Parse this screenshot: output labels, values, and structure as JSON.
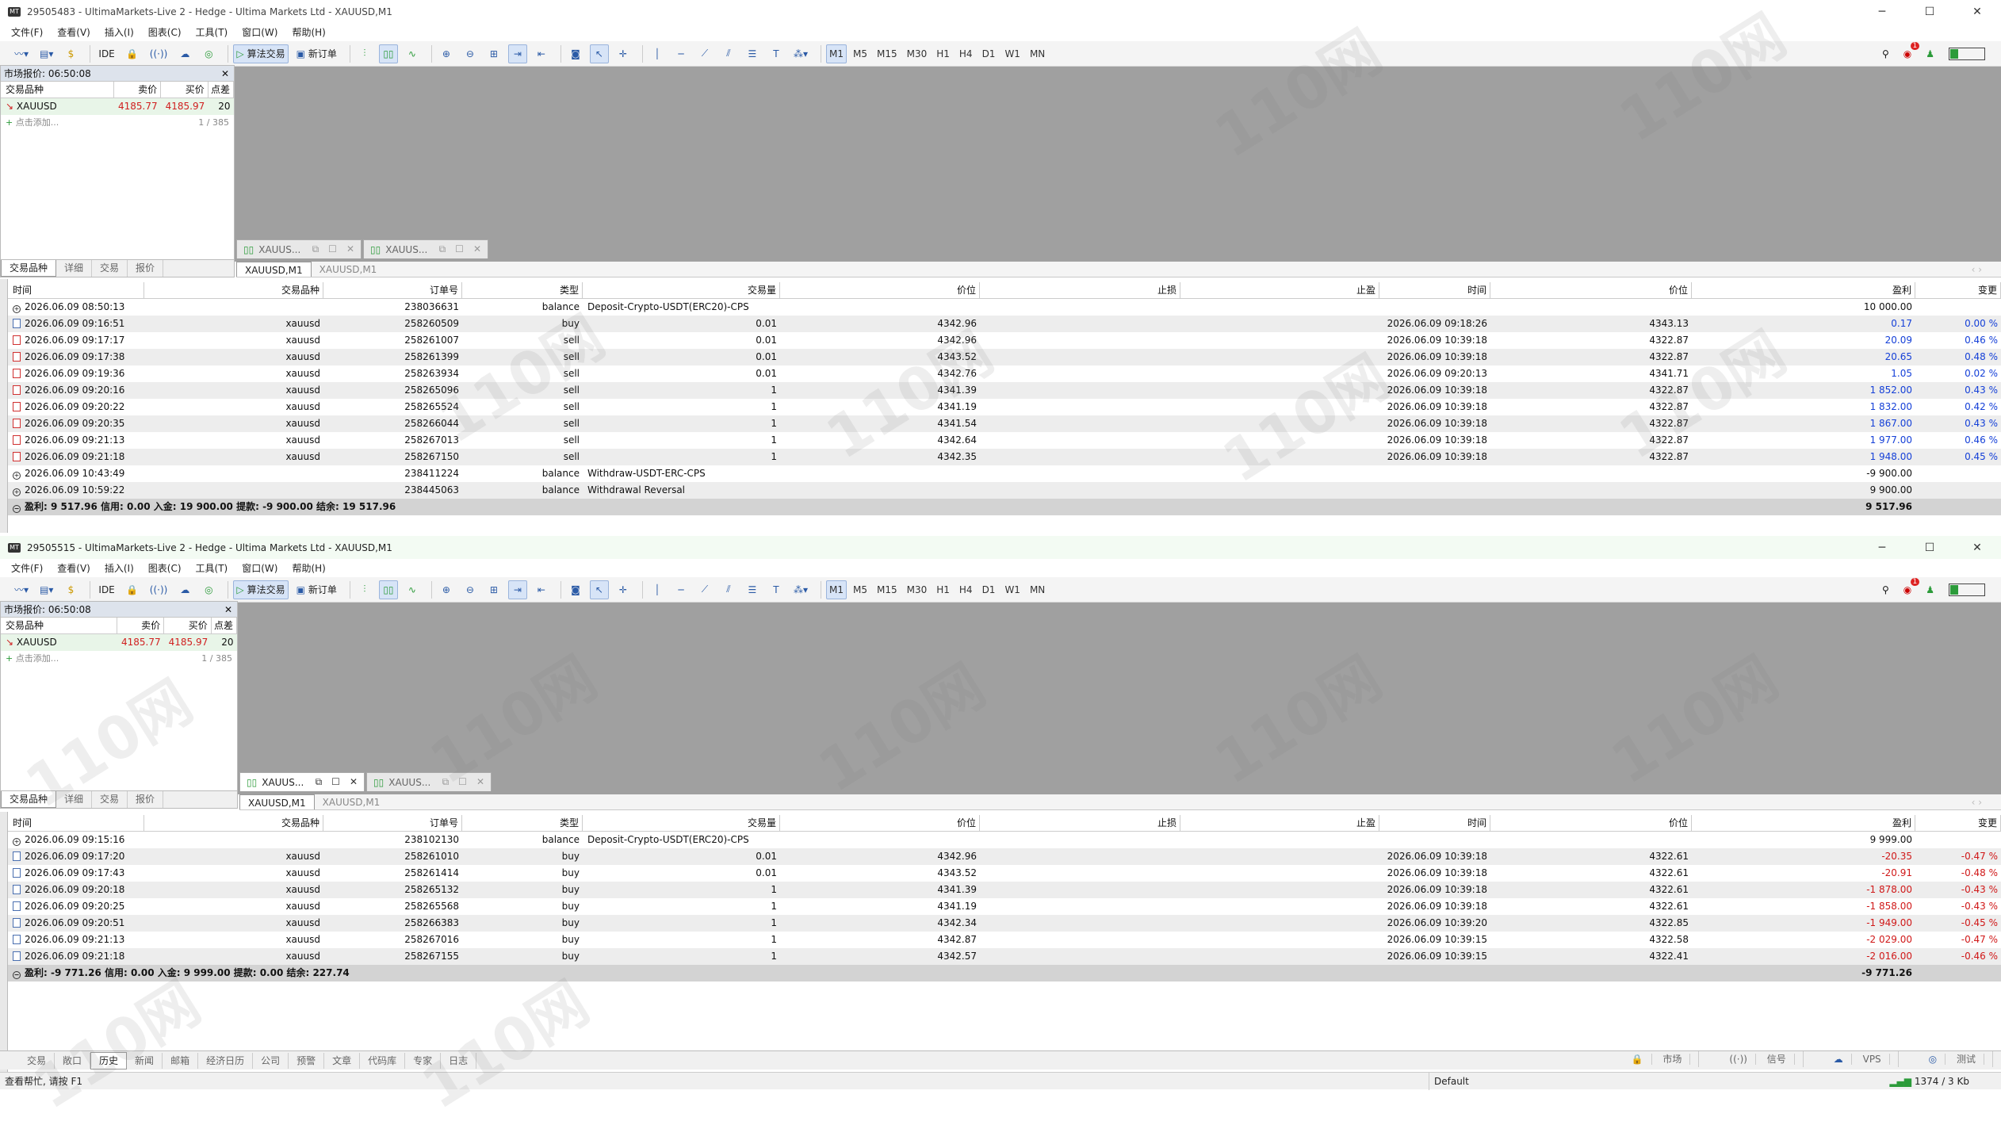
{
  "windows": [
    {
      "title": "29505483 - UltimaMarkets-Live 2 - Hedge - Ultima Markets Ltd - XAUUSD,M1",
      "history": {
        "rows": [
          {
            "time": "2026.06.09 08:50:13",
            "symbol": "",
            "order": "238036631",
            "type": "balance",
            "volume": "Deposit-Crypto-USDT(ERC20)-CPS",
            "price": "",
            "sl": "",
            "tp": "",
            "ctime": "",
            "cprice": "",
            "profit": "10 000.00",
            "change": "",
            "kind": "balance"
          },
          {
            "time": "2026.06.09 09:16:51",
            "symbol": "xauusd",
            "order": "258260509",
            "type": "buy",
            "volume": "0.01",
            "price": "4342.96",
            "sl": "",
            "tp": "",
            "ctime": "2026.06.09 09:18:26",
            "cprice": "4343.13",
            "profit": "0.17",
            "change": "0.00 %",
            "kind": "buy"
          },
          {
            "time": "2026.06.09 09:17:17",
            "symbol": "xauusd",
            "order": "258261007",
            "type": "sell",
            "volume": "0.01",
            "price": "4342.96",
            "sl": "",
            "tp": "",
            "ctime": "2026.06.09 10:39:18",
            "cprice": "4322.87",
            "profit": "20.09",
            "change": "0.46 %",
            "kind": "sell"
          },
          {
            "time": "2026.06.09 09:17:38",
            "symbol": "xauusd",
            "order": "258261399",
            "type": "sell",
            "volume": "0.01",
            "price": "4343.52",
            "sl": "",
            "tp": "",
            "ctime": "2026.06.09 10:39:18",
            "cprice": "4322.87",
            "profit": "20.65",
            "change": "0.48 %",
            "kind": "sell"
          },
          {
            "time": "2026.06.09 09:19:36",
            "symbol": "xauusd",
            "order": "258263934",
            "type": "sell",
            "volume": "0.01",
            "price": "4342.76",
            "sl": "",
            "tp": "",
            "ctime": "2026.06.09 09:20:13",
            "cprice": "4341.71",
            "profit": "1.05",
            "change": "0.02 %",
            "kind": "sell"
          },
          {
            "time": "2026.06.09 09:20:16",
            "symbol": "xauusd",
            "order": "258265096",
            "type": "sell",
            "volume": "1",
            "price": "4341.39",
            "sl": "",
            "tp": "",
            "ctime": "2026.06.09 10:39:18",
            "cprice": "4322.87",
            "profit": "1 852.00",
            "change": "0.43 %",
            "kind": "sell"
          },
          {
            "time": "2026.06.09 09:20:22",
            "symbol": "xauusd",
            "order": "258265524",
            "type": "sell",
            "volume": "1",
            "price": "4341.19",
            "sl": "",
            "tp": "",
            "ctime": "2026.06.09 10:39:18",
            "cprice": "4322.87",
            "profit": "1 832.00",
            "change": "0.42 %",
            "kind": "sell"
          },
          {
            "time": "2026.06.09 09:20:35",
            "symbol": "xauusd",
            "order": "258266044",
            "type": "sell",
            "volume": "1",
            "price": "4341.54",
            "sl": "",
            "tp": "",
            "ctime": "2026.06.09 10:39:18",
            "cprice": "4322.87",
            "profit": "1 867.00",
            "change": "0.43 %",
            "kind": "sell"
          },
          {
            "time": "2026.06.09 09:21:13",
            "symbol": "xauusd",
            "order": "258267013",
            "type": "sell",
            "volume": "1",
            "price": "4342.64",
            "sl": "",
            "tp": "",
            "ctime": "2026.06.09 10:39:18",
            "cprice": "4322.87",
            "profit": "1 977.00",
            "change": "0.46 %",
            "kind": "sell"
          },
          {
            "time": "2026.06.09 09:21:18",
            "symbol": "xauusd",
            "order": "258267150",
            "type": "sell",
            "volume": "1",
            "price": "4342.35",
            "sl": "",
            "tp": "",
            "ctime": "2026.06.09 10:39:18",
            "cprice": "4322.87",
            "profit": "1 948.00",
            "change": "0.45 %",
            "kind": "sell"
          },
          {
            "time": "2026.06.09 10:43:49",
            "symbol": "",
            "order": "238411224",
            "type": "balance",
            "volume": "Withdraw-USDT-ERC-CPS",
            "price": "",
            "sl": "",
            "tp": "",
            "ctime": "",
            "cprice": "",
            "profit": "-9 900.00",
            "change": "",
            "kind": "balance"
          },
          {
            "time": "2026.06.09 10:59:22",
            "symbol": "",
            "order": "238445063",
            "type": "balance",
            "volume": "Withdrawal Reversal",
            "price": "",
            "sl": "",
            "tp": "",
            "ctime": "",
            "cprice": "",
            "profit": "9 900.00",
            "change": "",
            "kind": "balance"
          }
        ],
        "total_label": "盈利: 9 517.96  信用: 0.00  入金: 19 900.00  提款: -9 900.00  结余: 19 517.96",
        "total_profit": "9 517.96"
      }
    },
    {
      "title": "29505515 - UltimaMarkets-Live 2 - Hedge - Ultima Markets Ltd - XAUUSD,M1",
      "history": {
        "rows": [
          {
            "time": "2026.06.09 09:15:16",
            "symbol": "",
            "order": "238102130",
            "type": "balance",
            "volume": "Deposit-Crypto-USDT(ERC20)-CPS",
            "price": "",
            "sl": "",
            "tp": "",
            "ctime": "",
            "cprice": "",
            "profit": "9 999.00",
            "change": "",
            "kind": "balance"
          },
          {
            "time": "2026.06.09 09:17:20",
            "symbol": "xauusd",
            "order": "258261010",
            "type": "buy",
            "volume": "0.01",
            "price": "4342.96",
            "sl": "",
            "tp": "",
            "ctime": "2026.06.09 10:39:18",
            "cprice": "4322.61",
            "profit": "-20.35",
            "change": "-0.47 %",
            "kind": "buy"
          },
          {
            "time": "2026.06.09 09:17:43",
            "symbol": "xauusd",
            "order": "258261414",
            "type": "buy",
            "volume": "0.01",
            "price": "4343.52",
            "sl": "",
            "tp": "",
            "ctime": "2026.06.09 10:39:18",
            "cprice": "4322.61",
            "profit": "-20.91",
            "change": "-0.48 %",
            "kind": "buy"
          },
          {
            "time": "2026.06.09 09:20:18",
            "symbol": "xauusd",
            "order": "258265132",
            "type": "buy",
            "volume": "1",
            "price": "4341.39",
            "sl": "",
            "tp": "",
            "ctime": "2026.06.09 10:39:18",
            "cprice": "4322.61",
            "profit": "-1 878.00",
            "change": "-0.43 %",
            "kind": "buy"
          },
          {
            "time": "2026.06.09 09:20:25",
            "symbol": "xauusd",
            "order": "258265568",
            "type": "buy",
            "volume": "1",
            "price": "4341.19",
            "sl": "",
            "tp": "",
            "ctime": "2026.06.09 10:39:18",
            "cprice": "4322.61",
            "profit": "-1 858.00",
            "change": "-0.43 %",
            "kind": "buy"
          },
          {
            "time": "2026.06.09 09:20:51",
            "symbol": "xauusd",
            "order": "258266383",
            "type": "buy",
            "volume": "1",
            "price": "4342.34",
            "sl": "",
            "tp": "",
            "ctime": "2026.06.09 10:39:20",
            "cprice": "4322.85",
            "profit": "-1 949.00",
            "change": "-0.45 %",
            "kind": "buy"
          },
          {
            "time": "2026.06.09 09:21:13",
            "symbol": "xauusd",
            "order": "258267016",
            "type": "buy",
            "volume": "1",
            "price": "4342.87",
            "sl": "",
            "tp": "",
            "ctime": "2026.06.09 10:39:15",
            "cprice": "4322.58",
            "profit": "-2 029.00",
            "change": "-0.47 %",
            "kind": "buy"
          },
          {
            "time": "2026.06.09 09:21:18",
            "symbol": "xauusd",
            "order": "258267155",
            "type": "buy",
            "volume": "1",
            "price": "4342.57",
            "sl": "",
            "tp": "",
            "ctime": "2026.06.09 10:39:15",
            "cprice": "4322.41",
            "profit": "-2 016.00",
            "change": "-0.46 %",
            "kind": "buy"
          }
        ],
        "total_label": "盈利: -9 771.26  信用: 0.00  入金: 9 999.00  提款: 0.00  结余: 227.74",
        "total_profit": "-9 771.26"
      }
    }
  ],
  "menu": [
    "文件(F)",
    "查看(V)",
    "插入(I)",
    "图表(C)",
    "工具(T)",
    "窗口(W)",
    "帮助(H)"
  ],
  "toolbar": {
    "ide": "IDE",
    "algo": "算法交易",
    "new_order": "新订单",
    "timeframes": [
      "M1",
      "M5",
      "M15",
      "M30",
      "H1",
      "H4",
      "D1",
      "W1",
      "MN"
    ]
  },
  "market_watch": {
    "title": "市场报价: 06:50:08",
    "headers": [
      "交易品种",
      "卖价",
      "买价",
      "点差"
    ],
    "symbol": "XAUUSD",
    "bid": "4185.77",
    "ask": "4185.97",
    "spread": "20",
    "add": "点击添加...",
    "count": "1 / 385",
    "tabs": [
      "交易品种",
      "详细",
      "交易",
      "报价"
    ]
  },
  "chart_tabs": [
    "XAUUS...",
    "XAUUS..."
  ],
  "sub_tabs": [
    "XAUUSD,M1",
    "XAUUSD,M1"
  ],
  "history_headers": [
    "时间",
    "交易品种",
    "订单号",
    "类型",
    "交易量",
    "价位",
    "止损",
    "止盈",
    "时间",
    "价位",
    "盈利",
    "变更"
  ],
  "bottom_tabs": [
    "交易",
    "敞口",
    "历史",
    "新闻",
    "邮箱",
    "经济日历",
    "公司",
    "预警",
    "文章",
    "代码库",
    "专家",
    "日志"
  ],
  "bottom_right": [
    "市场",
    "信号",
    "VPS",
    "测试"
  ],
  "status": {
    "help": "查看帮忙, 请按 F1",
    "profile": "Default",
    "traffic": "1374 / 3 Kb"
  },
  "watermark": "110网",
  "colors": {
    "profit": "#1540d8",
    "loss": "#d01818",
    "chart_bg": "#a0a0a0"
  }
}
